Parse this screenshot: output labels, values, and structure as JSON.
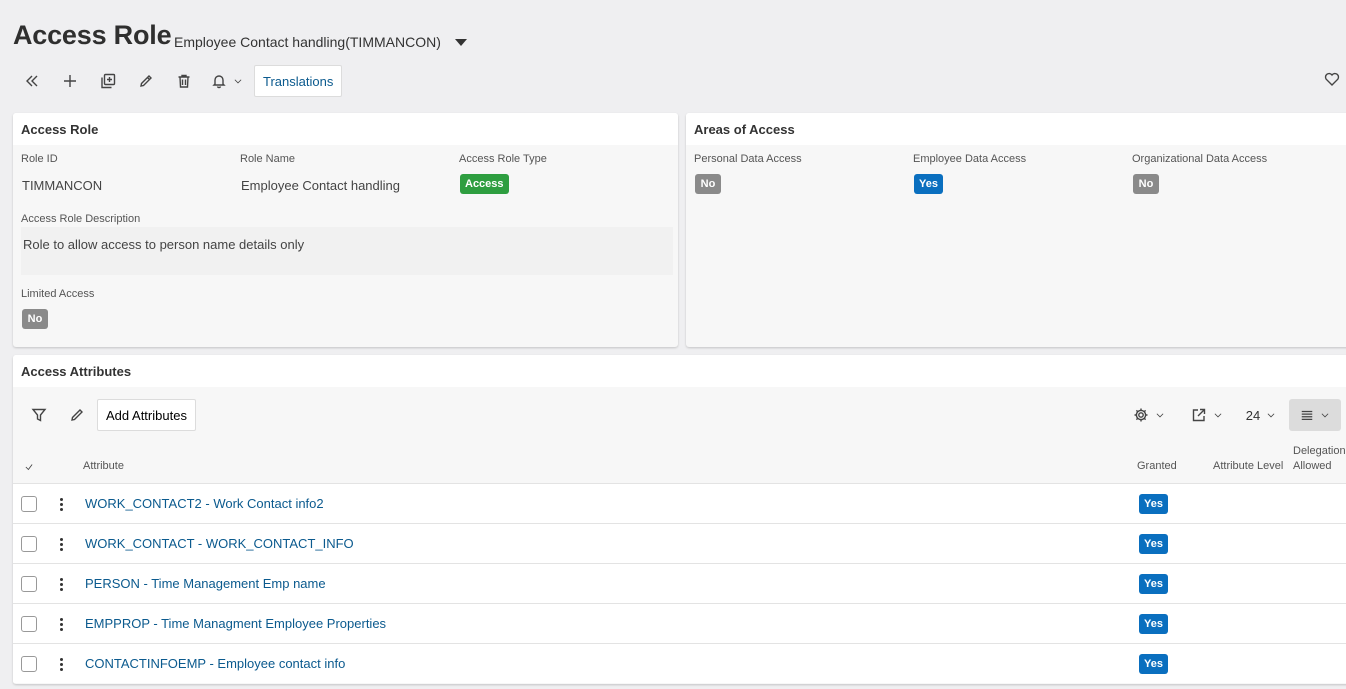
{
  "header": {
    "title": "Access Role",
    "record": "Employee Contact handling(TIMMANCON)"
  },
  "toolbar": {
    "translations_label": "Translations",
    "icons": [
      "double-chevron-left-icon",
      "plus-icon",
      "duplicate-icon",
      "pencil-icon",
      "trash-icon",
      "bell-icon",
      "heart-icon"
    ]
  },
  "access_role": {
    "heading": "Access Role",
    "role_id_label": "Role ID",
    "role_id": "TIMMANCON",
    "role_name_label": "Role Name",
    "role_name": "Employee Contact handling",
    "role_type_label": "Access Role Type",
    "role_type": "Access",
    "description_label": "Access Role Description",
    "description": "Role to allow access to person name details only",
    "limited_label": "Limited Access",
    "limited": "No"
  },
  "areas": {
    "heading": "Areas of Access",
    "personal_label": "Personal Data Access",
    "personal": "No",
    "employee_label": "Employee Data Access",
    "employee": "Yes",
    "org_label": "Organizational Data Access",
    "org": "No"
  },
  "attributes": {
    "heading": "Access Attributes",
    "add_label": "Add Attributes",
    "page_size": "24",
    "columns": {
      "attribute": "Attribute",
      "granted": "Granted",
      "level": "Attribute Level",
      "delegation_line1": "Delegation",
      "delegation_line2": "Allowed"
    },
    "rows": [
      {
        "name": "WORK_CONTACT2 - Work Contact info2",
        "granted": "Yes"
      },
      {
        "name": "WORK_CONTACT - WORK_CONTACT_INFO",
        "granted": "Yes"
      },
      {
        "name": "PERSON - Time Management Emp name",
        "granted": "Yes"
      },
      {
        "name": "EMPPROP - Time Managment Employee Properties",
        "granted": "Yes"
      },
      {
        "name": "CONTACTINFOEMP - Employee contact info",
        "granted": "Yes"
      }
    ]
  },
  "colors": {
    "link": "#0b5a8e",
    "yes_badge": "#0a6fbf",
    "access_badge": "#2e9e40",
    "no_badge": "#8a8a8a"
  }
}
